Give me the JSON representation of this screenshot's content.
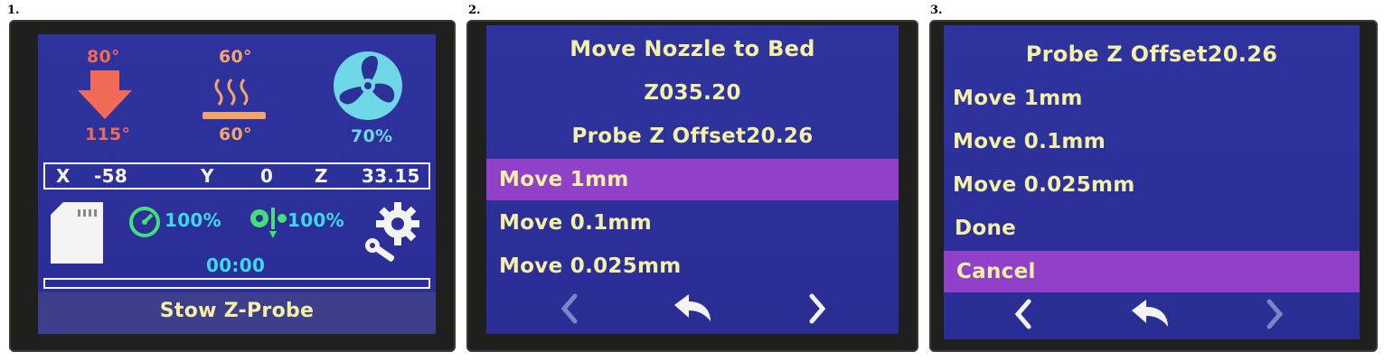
{
  "labels": [
    "1.",
    "2.",
    "3."
  ],
  "screen1": {
    "nozzle": {
      "target": "80°",
      "current": "115°",
      "icon": "nozzle-down-arrow-icon"
    },
    "bed": {
      "target": "60°",
      "current": "60°",
      "icon": "heated-bed-icon"
    },
    "fan": {
      "speed": "70%",
      "icon": "fan-icon"
    },
    "position": {
      "x_label": "X",
      "x_val": "-58",
      "y_label": "Y",
      "y_val": "0",
      "z_label": "Z",
      "z_val": "33.15"
    },
    "feed_rate": "100%",
    "flow_rate": "100%",
    "time": "00:00",
    "status": "Stow Z-Probe",
    "progress": 0,
    "colors": {
      "hot": "#f06a55",
      "bed": "#f2a56a",
      "fan": "#6fd6e6",
      "accent": "#3ed8ec",
      "green": "#43e07a"
    }
  },
  "screen2": {
    "title": "Move Nozzle to Bed",
    "z_value": "Z035.20",
    "probe_offset": "Probe Z Offset20.26",
    "items": [
      "Move 1mm",
      "Move 0.1mm",
      "Move 0.025mm"
    ],
    "selected_index": 0,
    "nav": [
      "chevron-left-icon",
      "back-arrow-icon",
      "chevron-right-icon"
    ]
  },
  "screen3": {
    "title": "Probe Z Offset20.26",
    "items": [
      "Move 1mm",
      "Move 0.1mm",
      "Move 0.025mm",
      "Done",
      "Cancel"
    ],
    "selected_index": 4,
    "nav": [
      "chevron-left-icon",
      "back-arrow-icon",
      "chevron-right-icon"
    ]
  }
}
